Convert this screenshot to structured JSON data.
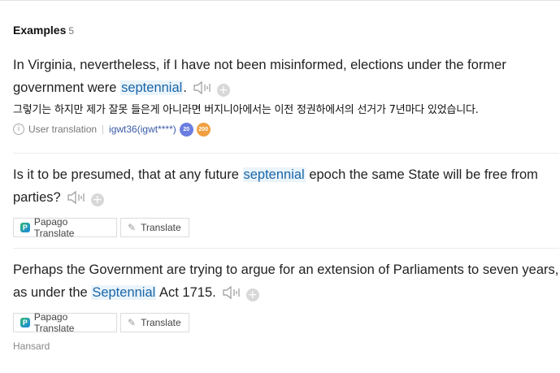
{
  "header": {
    "title": "Examples",
    "count": "5"
  },
  "examples": [
    {
      "parts": [
        "In Virginia, nevertheless, if I have not been misinformed, elections under the former government were ",
        "septennial",
        "."
      ],
      "translation": "그렇기는 하지만 제가 잘못 들은게 아니라면 버지니아에서는 이전 정권하에서의 선거가 7년마다 있었습니다.",
      "meta": {
        "label": "User translation",
        "user": "igwt36(igwt****)",
        "badges": [
          "20 14",
          "200"
        ]
      }
    },
    {
      "parts": [
        "Is it to be presumed, that at any future ",
        "septennial",
        " epoch the same State will be free from parties?"
      ],
      "buttons": {
        "papago": "Papago Translate",
        "translate": "Translate"
      }
    },
    {
      "parts": [
        "Perhaps the Government are trying to argue for an extension of Parliaments to seven years, as under the ",
        "Septennial",
        " Act 1715."
      ],
      "buttons": {
        "papago": "Papago Translate",
        "translate": "Translate"
      },
      "source": "Hansard"
    }
  ],
  "icons": {
    "sound": "speaker-icon",
    "add": "plus-icon",
    "info": "info-icon",
    "papago": "papago-icon",
    "translate": "pencil-icon"
  },
  "colors": {
    "highlight_bg": "#eaf4fb",
    "highlight_text": "#1a66a8",
    "user_link": "#3a5aa8",
    "badge_level": "#6a7de0",
    "badge_points": "#f0a040"
  }
}
